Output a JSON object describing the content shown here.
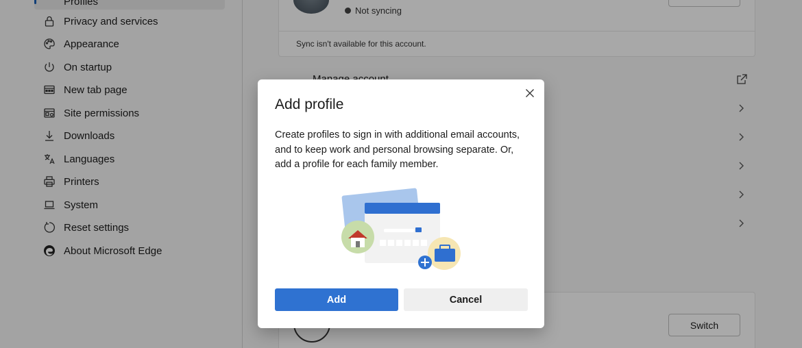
{
  "sidebar": {
    "active_label": "Profiles",
    "items": [
      {
        "label": "Privacy and services",
        "icon": "lock-icon"
      },
      {
        "label": "Appearance",
        "icon": "palette-icon"
      },
      {
        "label": "On startup",
        "icon": "power-icon"
      },
      {
        "label": "New tab page",
        "icon": "grid-icon"
      },
      {
        "label": "Site permissions",
        "icon": "site-permissions-icon"
      },
      {
        "label": "Downloads",
        "icon": "download-icon"
      },
      {
        "label": "Languages",
        "icon": "languages-icon"
      },
      {
        "label": "Printers",
        "icon": "printer-icon"
      },
      {
        "label": "System",
        "icon": "laptop-icon"
      },
      {
        "label": "Reset settings",
        "icon": "reset-icon"
      },
      {
        "label": "About Microsoft Edge",
        "icon": "edge-logo-icon"
      }
    ]
  },
  "profile_card": {
    "sync_status": "Not syncing",
    "sync_note": "Sync isn't available for this account."
  },
  "manage": {
    "label": "Manage account"
  },
  "other_profile": {
    "switch_label": "Switch"
  },
  "dialog": {
    "title": "Add profile",
    "description": "Create profiles to sign in with additional email accounts, and to keep work and personal browsing separate. Or, add a profile for each family member.",
    "add_label": "Add",
    "cancel_label": "Cancel"
  },
  "colors": {
    "accent": "#2f72d1",
    "overlay": "#000000"
  }
}
